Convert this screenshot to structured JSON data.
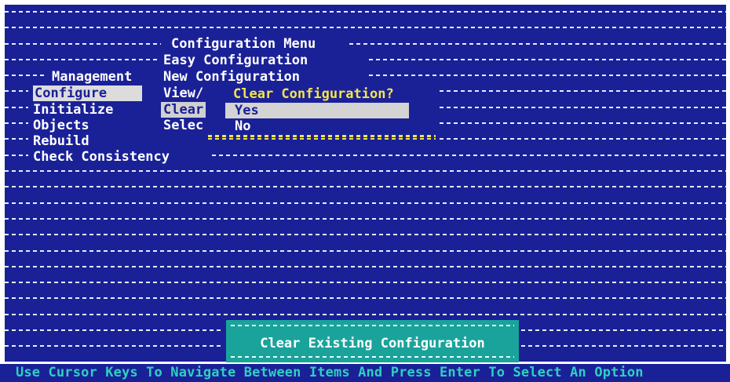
{
  "menu": {
    "title": "Configuration Menu",
    "management_label": "Management",
    "items": [
      "Configure",
      "Initialize",
      "Objects",
      "Rebuild",
      "Check Consistency"
    ],
    "config_items": [
      "Easy Configuration",
      "New Configuration",
      "View/",
      "Clear",
      "Selec"
    ]
  },
  "dialog": {
    "title": "Clear Configuration?",
    "options": [
      "Yes",
      "No"
    ],
    "selected": "Yes"
  },
  "status": {
    "text": "Clear Existing Configuration"
  },
  "helpbar": {
    "text": "Use Cursor Keys To Navigate Between Items And Press Enter To Select An Option"
  },
  "colors": {
    "background": "#1a2197",
    "status_box": "#1aa39b",
    "dialog_accent": "#f4e44a",
    "help_text": "#2fd0c0"
  }
}
